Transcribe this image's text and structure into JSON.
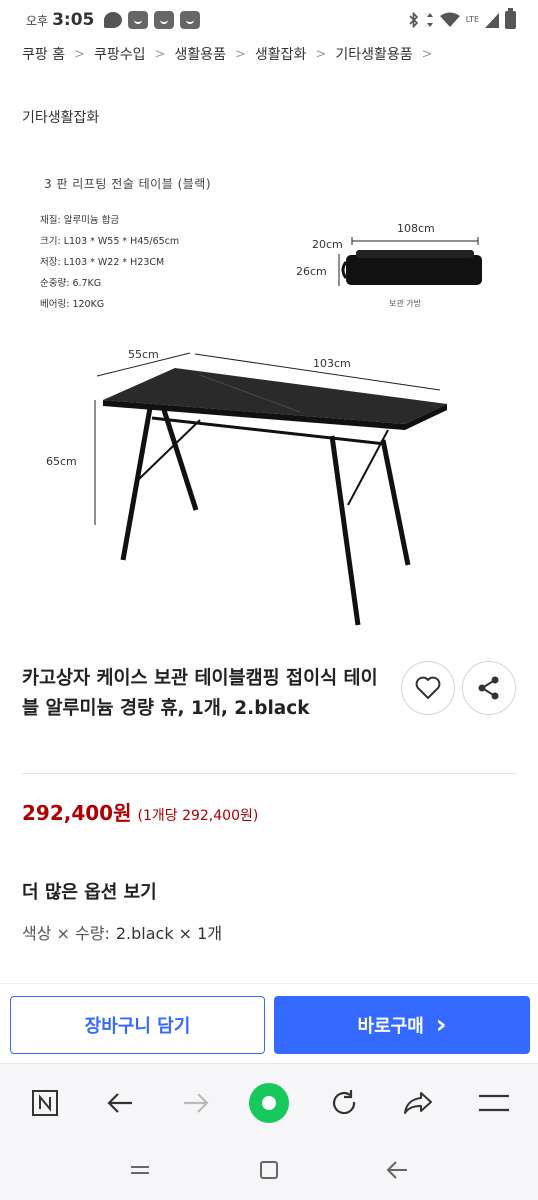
{
  "status_bar": {
    "ampm": "오후",
    "time": "3:05",
    "network": "LTE"
  },
  "breadcrumb": [
    "쿠팡 홈",
    "쿠팡수입",
    "생활용품",
    "생활잡화",
    "기타생활용품"
  ],
  "category_title": "기타생활잡화",
  "product_image": {
    "spec_title": "3 판 리프팅 전술 테이블 (블랙)",
    "specs": [
      "재질: 알루미늄 합금",
      "크기: L103 * W55 * H45/65cm",
      "저장: L103 * W22 * H23CM",
      "순중량: 6.7KG",
      "베어링: 120KG"
    ],
    "bag_length": "108cm",
    "bag_width": "20cm",
    "bag_height": "26cm",
    "bag_caption": "보관 가방",
    "table_width": "55cm",
    "table_length": "103cm",
    "table_height": "65cm"
  },
  "product": {
    "title": "카고상자 케이스 보관 테이블캠핑 접이식 테이블 알루미늄 경량 휴, 1개, 2.black",
    "price": "292,400원",
    "unit_price": "(1개당 292,400원)",
    "more_options": "더 많은 옵션 보기",
    "option_label": "색상 × 수량:",
    "option_value": "2.black × 1개"
  },
  "actions": {
    "cart": "장바구니 담기",
    "buy": "바로구매",
    "buy_chevron": "›"
  },
  "colors": {
    "accent": "#346aff",
    "price": "#ae0000",
    "browser_home": "#17c85a"
  }
}
